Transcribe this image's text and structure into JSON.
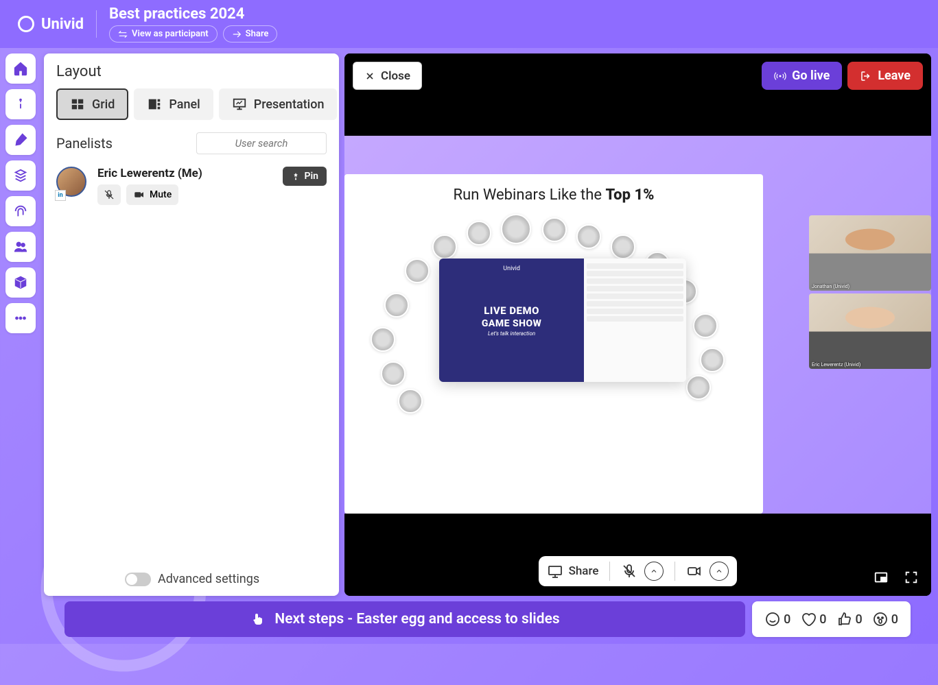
{
  "brand": "Univid",
  "header": {
    "title": "Best practices 2024",
    "view_as": "View as participant",
    "share": "Share"
  },
  "layout_panel": {
    "title": "Layout",
    "grid": "Grid",
    "panel_opt": "Panel",
    "presentation": "Presentation",
    "panelists_title": "Panelists",
    "search_placeholder": "User search",
    "advanced": "Advanced settings"
  },
  "panelist": {
    "name": "Eric Lewerentz (Me)",
    "mute": "Mute",
    "pin": "Pin",
    "badge": "in"
  },
  "stage": {
    "close": "Close",
    "go_live": "Go live",
    "leave": "Leave",
    "share": "Share"
  },
  "slide": {
    "heading_a": "Run Webinars Like the ",
    "heading_b": "Top 1%",
    "demo_logo": "Univid",
    "demo_l1": "LIVE DEMO",
    "demo_l2": "GAME SHOW",
    "demo_l3": "Let's talk interaction"
  },
  "banner": "Next steps - Easter egg and access to slides",
  "reactions": {
    "smile": "0",
    "heart": "0",
    "thumb": "0",
    "wow": "0"
  }
}
